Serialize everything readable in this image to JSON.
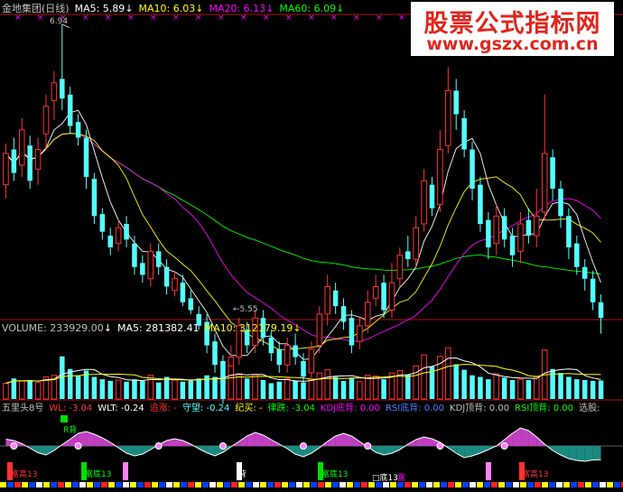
{
  "main_header": {
    "title": "金地集团(日线)",
    "ma5": "MA5: 5.89",
    "ma10": "MA10: 6.03",
    "ma20": "MA20: 6.13",
    "ma60": "MA60: 6.09",
    "arrow": "↓"
  },
  "watermark": {
    "title": "股票公式指标网",
    "url": "www.gszx.com.cn"
  },
  "annotations": {
    "high": "6.94",
    "low": "←5.55"
  },
  "volume_header": {
    "volume": "VOLUME: 233929.00",
    "ma5": "MA5: 281382.41",
    "ma10": "MA10: 312179.19",
    "arrow": "↓"
  },
  "indicator_header": {
    "name": "五里头8号",
    "wl": "WL: -3.04",
    "wlt": "WLT: -0.24",
    "zhui": "追涨: -",
    "shou": "守望: -0.24",
    "ji": "纪买: -",
    "lv": "律跌: -3.04",
    "kdj_di": "KDJ底背: 0.00",
    "rsi_di": "RSI底背: 0.00",
    "kdj_ding": "KDJ顶背: 0.00",
    "rsi_ding": "RSI顶背: 0.00",
    "right": "选股:",
    "arrow": "↓"
  },
  "signals": {
    "r_bei": "R背",
    "fuqu_gao": "富高13",
    "fuqu_di": "富底13",
    "bei": "背",
    "box_label": "□底13",
    "he": "富"
  },
  "colors": {
    "up": "#ff3232",
    "down": "#54ffff",
    "ma5": "#ffffff",
    "ma10": "#ffff00",
    "ma20": "#ff00ff",
    "ma60": "#00ff00",
    "axis": "#b01010",
    "magenta_fill": "#c040c0",
    "teal_fill": "#1a8a80"
  },
  "chart_data": {
    "type": "candlestick",
    "ylim": [
      5.45,
      6.98
    ],
    "high_marker": 6.94,
    "low_marker": 5.55,
    "candles": [
      [
        6.12,
        6.28,
        6.05,
        6.33
      ],
      [
        6.3,
        6.18,
        6.14,
        6.36
      ],
      [
        6.22,
        6.4,
        6.16,
        6.46
      ],
      [
        6.32,
        6.14,
        6.1,
        6.37
      ],
      [
        6.2,
        6.3,
        6.12,
        6.36
      ],
      [
        6.38,
        6.52,
        6.3,
        6.58
      ],
      [
        6.55,
        6.64,
        6.45,
        6.7
      ],
      [
        6.66,
        6.56,
        6.5,
        6.94
      ],
      [
        6.58,
        6.42,
        6.38,
        6.62
      ],
      [
        6.44,
        6.36,
        6.32,
        6.48
      ],
      [
        6.36,
        6.16,
        6.1,
        6.4
      ],
      [
        6.15,
        5.96,
        5.92,
        6.18
      ],
      [
        5.97,
        5.88,
        5.84,
        6.0
      ],
      [
        5.86,
        5.8,
        5.76,
        5.9
      ],
      [
        5.82,
        5.9,
        5.78,
        5.94
      ],
      [
        5.92,
        5.84,
        5.8,
        5.96
      ],
      [
        5.82,
        5.7,
        5.66,
        5.86
      ],
      [
        5.72,
        5.66,
        5.62,
        5.76
      ],
      [
        5.64,
        5.78,
        5.6,
        5.82
      ],
      [
        5.78,
        5.7,
        5.66,
        5.82
      ],
      [
        5.7,
        5.6,
        5.56,
        5.74
      ],
      [
        5.58,
        5.64,
        5.55,
        5.68
      ],
      [
        5.62,
        5.52,
        5.5,
        5.66
      ],
      [
        5.54,
        5.48,
        5.46,
        5.58
      ],
      [
        5.46,
        5.4,
        5.38,
        5.5
      ],
      [
        5.42,
        5.3,
        5.26,
        5.46
      ],
      [
        5.32,
        5.2,
        5.16,
        5.36
      ],
      [
        5.22,
        5.1,
        5.0,
        5.25
      ],
      [
        5.1,
        5.24,
        5.06,
        5.3
      ],
      [
        5.24,
        5.4,
        5.2,
        5.44
      ],
      [
        5.38,
        5.3,
        5.26,
        5.42
      ],
      [
        5.3,
        5.44,
        5.26,
        5.48
      ],
      [
        5.44,
        5.34,
        5.3,
        5.48
      ],
      [
        5.34,
        5.26,
        5.22,
        5.38
      ],
      [
        5.28,
        5.2,
        5.16,
        5.32
      ],
      [
        5.2,
        5.3,
        5.16,
        5.34
      ],
      [
        5.3,
        5.24,
        5.2,
        5.36
      ],
      [
        5.22,
        5.14,
        5.08,
        5.26
      ],
      [
        5.16,
        5.28,
        5.12,
        5.32
      ],
      [
        5.3,
        5.46,
        5.26,
        5.5
      ],
      [
        5.46,
        5.6,
        5.4,
        5.66
      ],
      [
        5.58,
        5.5,
        5.46,
        5.62
      ],
      [
        5.5,
        5.42,
        5.38,
        5.54
      ],
      [
        5.44,
        5.3,
        5.26,
        5.48
      ],
      [
        5.32,
        5.4,
        5.28,
        5.44
      ],
      [
        5.4,
        5.52,
        5.36,
        5.58
      ],
      [
        5.54,
        5.6,
        5.5,
        5.66
      ],
      [
        5.62,
        5.48,
        5.44,
        5.66
      ],
      [
        5.48,
        5.62,
        5.44,
        5.72
      ],
      [
        5.64,
        5.76,
        5.6,
        5.8
      ],
      [
        5.78,
        5.74,
        5.7,
        5.86
      ],
      [
        5.74,
        5.9,
        5.7,
        5.96
      ],
      [
        5.92,
        6.14,
        5.88,
        6.2
      ],
      [
        6.12,
        6.0,
        5.96,
        6.16
      ],
      [
        6.02,
        6.3,
        5.98,
        6.4
      ],
      [
        6.32,
        6.6,
        6.28,
        6.72
      ],
      [
        6.6,
        6.48,
        6.4,
        6.66
      ],
      [
        6.46,
        6.3,
        6.26,
        6.5
      ],
      [
        6.3,
        6.1,
        6.04,
        6.34
      ],
      [
        6.12,
        5.92,
        5.88,
        6.16
      ],
      [
        5.94,
        5.8,
        5.74,
        5.98
      ],
      [
        5.82,
        5.96,
        5.76,
        6.02
      ],
      [
        5.96,
        5.84,
        5.8,
        6.0
      ],
      [
        5.86,
        5.76,
        5.7,
        5.9
      ],
      [
        5.78,
        5.92,
        5.72,
        5.98
      ],
      [
        5.94,
        5.86,
        5.82,
        6.0
      ],
      [
        5.86,
        5.96,
        5.8,
        6.1
      ],
      [
        5.98,
        6.28,
        5.94,
        6.58
      ],
      [
        6.26,
        6.1,
        6.04,
        6.3
      ],
      [
        6.1,
        5.96,
        5.9,
        6.14
      ],
      [
        5.96,
        5.8,
        5.74,
        6.0
      ],
      [
        5.82,
        5.7,
        5.66,
        5.86
      ],
      [
        5.7,
        5.64,
        5.58,
        5.74
      ],
      [
        5.64,
        5.52,
        5.48,
        5.68
      ],
      [
        5.52,
        5.44,
        5.36,
        5.56
      ]
    ],
    "volume": {
      "ylim": [
        0,
        800000
      ],
      "values": [
        200000,
        260000,
        230000,
        240000,
        210000,
        280000,
        300000,
        540000,
        380000,
        300000,
        360000,
        280000,
        250000,
        230000,
        240000,
        220000,
        250000,
        230000,
        300000,
        210000,
        280000,
        240000,
        220000,
        230000,
        260000,
        300000,
        280000,
        250000,
        420000,
        320000,
        260000,
        310000,
        240000,
        200000,
        220000,
        260000,
        230000,
        210000,
        250000,
        330000,
        370000,
        280000,
        230000,
        270000,
        220000,
        300000,
        290000,
        250000,
        330000,
        360000,
        310000,
        420000,
        560000,
        410000,
        540000,
        650000,
        440000,
        370000,
        300000,
        280000,
        250000,
        320000,
        270000,
        240000,
        250000,
        240000,
        290000,
        620000,
        380000,
        330000,
        280000,
        250000,
        240000,
        230000,
        234000
      ]
    },
    "indicator": {
      "values": [
        1.5,
        1.2,
        0.5,
        -0.5,
        -1.5,
        -2,
        -1,
        0.3,
        1.5,
        2.8,
        3.2,
        2.6,
        1.8,
        0.8,
        -0.4,
        -1.6,
        -2.2,
        -1.8,
        -0.8,
        0.3,
        1.2,
        1.6,
        1.2,
        0.4,
        -0.6,
        -1.5,
        -2.2,
        -1.4,
        -0.2,
        1,
        2.2,
        3,
        2.4,
        1.4,
        0.4,
        -0.6,
        -1.8,
        -2.4,
        -1.6,
        -0.4,
        1,
        2.2,
        2.8,
        2.2,
        1,
        -0.2,
        -1.4,
        -2,
        -1.6,
        -0.8,
        0.4,
        1.4,
        2,
        1.6,
        0.8,
        -0.4,
        -1.6,
        -2.6,
        -2.2,
        -1.6,
        -0.8,
        0,
        1.4,
        2.8,
        4,
        3.4,
        2,
        0.4,
        -1,
        -2,
        -2.8,
        -3.2,
        -3.4,
        -3.1,
        -3.04
      ]
    }
  }
}
